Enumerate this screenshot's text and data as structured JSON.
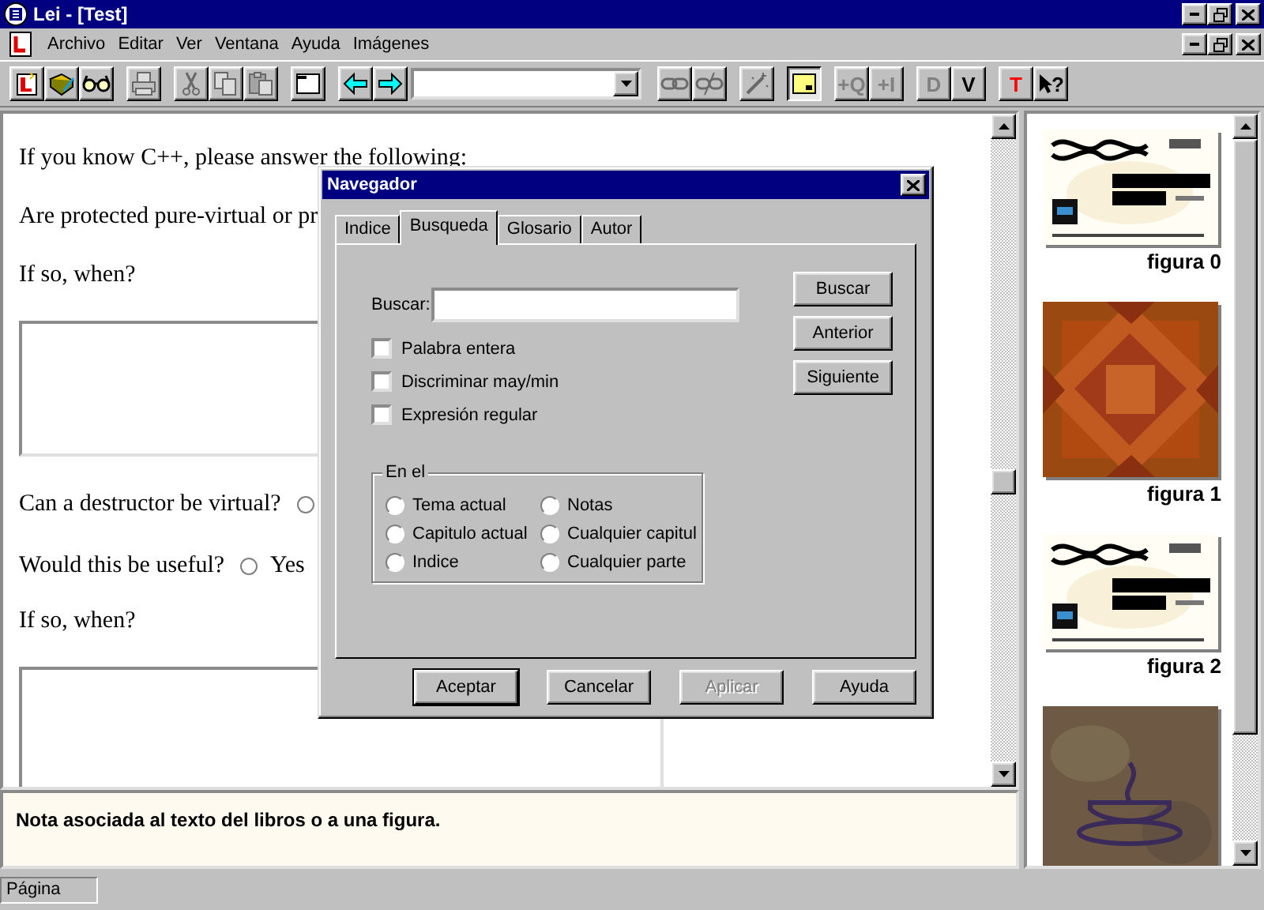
{
  "window": {
    "title": "Lei - [Test]"
  },
  "menu": [
    "Archivo",
    "Editar",
    "Ver",
    "Ventana",
    "Ayuda",
    "Imágenes"
  ],
  "toolbar": [
    {
      "kind": "icon",
      "disabled": false
    },
    {
      "kind": "icon",
      "disabled": false
    },
    {
      "kind": "icon",
      "disabled": false
    },
    {
      "kind": "separator"
    },
    {
      "kind": "icon",
      "disabled": true
    },
    {
      "kind": "separator"
    },
    {
      "kind": "icon",
      "disabled": true
    },
    {
      "kind": "icon",
      "disabled": true
    },
    {
      "kind": "icon",
      "disabled": true
    },
    {
      "kind": "separator"
    },
    {
      "kind": "icon",
      "disabled": false
    },
    {
      "kind": "separator"
    },
    {
      "kind": "icon",
      "disabled": false
    },
    {
      "kind": "icon",
      "disabled": false
    },
    {
      "kind": "combo"
    },
    {
      "kind": "icon",
      "disabled": true
    },
    {
      "kind": "icon",
      "disabled": true
    },
    {
      "kind": "separator"
    },
    {
      "kind": "icon",
      "disabled": true
    },
    {
      "kind": "separator"
    },
    {
      "kind": "icon",
      "disabled": false,
      "pressed": true
    },
    {
      "kind": "separator"
    },
    {
      "kind": "letter",
      "label": "+Q",
      "disabled": true
    },
    {
      "kind": "letter",
      "label": "+I",
      "disabled": true
    },
    {
      "kind": "separator"
    },
    {
      "kind": "letter",
      "label": "D",
      "disabled": true
    },
    {
      "kind": "letter",
      "label": "V",
      "disabled": false
    },
    {
      "kind": "separator"
    },
    {
      "kind": "letter",
      "label": "T",
      "disabled": false,
      "color": "#ff0000"
    },
    {
      "kind": "help",
      "label": "?",
      "disabled": false
    }
  ],
  "document": [
    {
      "kind": "text",
      "text": "If you know C++, please answer the following:"
    },
    {
      "kind": "text",
      "text": "Are protected pure-virtual or pr"
    },
    {
      "kind": "text",
      "text": "If so, when?"
    },
    {
      "kind": "textarea"
    },
    {
      "kind": "question",
      "text": "Can a destructor be virtual?",
      "options": [
        {
          "selected": false
        }
      ]
    },
    {
      "kind": "question",
      "text": "Would this be useful?",
      "options": [
        {
          "label": "Yes",
          "selected": false
        }
      ]
    },
    {
      "kind": "text",
      "text": "If so, when?"
    },
    {
      "kind": "textarea"
    }
  ],
  "note": "Nota asociada al texto del libros o a una figura.",
  "figures": [
    {
      "kind": "picture",
      "caption": "figura 0"
    },
    {
      "kind": "picture",
      "caption": "figura 1"
    },
    {
      "kind": "picture",
      "caption": "figura 2"
    },
    {
      "kind": "picture"
    }
  ],
  "status_bar": {
    "panels": [
      "Página"
    ]
  },
  "dialog": {
    "title": "Navegador",
    "tabs": [
      {
        "label": "Indice",
        "selected": false
      },
      {
        "label": "Busqueda",
        "selected": true
      },
      {
        "label": "Glosario",
        "selected": false
      },
      {
        "label": "Autor",
        "selected": false
      }
    ],
    "search": {
      "label": "Buscar:"
    },
    "action_buttons": [
      "Buscar",
      "Anterior",
      "Siguiente"
    ],
    "options": [
      {
        "label": "Palabra entera",
        "checked": false
      },
      {
        "label": "Discriminar may/min",
        "checked": false
      },
      {
        "label": "Expresión regular",
        "checked": false
      }
    ],
    "scope": {
      "title": "En el",
      "options": [
        {
          "label": "Tema actual",
          "selected": false
        },
        {
          "label": "Notas",
          "selected": false
        },
        {
          "label": "Capitulo actual",
          "selected": false
        },
        {
          "label": "Cualquier capitul",
          "selected": false
        },
        {
          "label": "Indice",
          "selected": false
        },
        {
          "label": "Cualquier parte",
          "selected": false
        }
      ]
    },
    "buttons": [
      {
        "label": "Aceptar",
        "default": true,
        "disabled": false
      },
      {
        "label": "Cancelar",
        "default": false,
        "disabled": false
      },
      {
        "label": "Aplicar",
        "default": false,
        "disabled": true
      },
      {
        "label": "Ayuda",
        "default": false,
        "disabled": false
      }
    ]
  }
}
